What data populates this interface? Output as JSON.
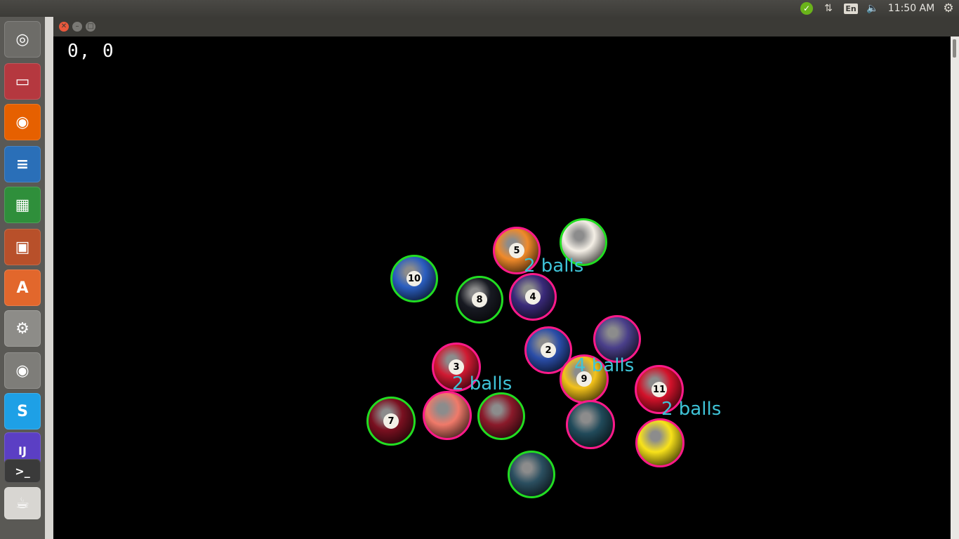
{
  "topbar": {
    "input_source": "En",
    "clock": "11:50 AM"
  },
  "launcher": {
    "items": [
      {
        "name": "ubuntu-dash-icon",
        "bg": "#6d6c68",
        "glyph": "◎"
      },
      {
        "name": "files-icon",
        "bg": "#b5383f",
        "glyph": "▭"
      },
      {
        "name": "firefox-icon",
        "bg": "#e66000",
        "glyph": "◉"
      },
      {
        "name": "writer-icon",
        "bg": "#2a6fb8",
        "glyph": "≡"
      },
      {
        "name": "calc-icon",
        "bg": "#2f8f3b",
        "glyph": "▦"
      },
      {
        "name": "impress-icon",
        "bg": "#b8502a",
        "glyph": "▣"
      },
      {
        "name": "software-center-icon",
        "bg": "#e2672c",
        "glyph": "A"
      },
      {
        "name": "system-settings-icon",
        "bg": "#8d8c88",
        "glyph": "⚙"
      },
      {
        "name": "chrome-icon",
        "bg": "#7e7d79",
        "glyph": "◉"
      },
      {
        "name": "skype-icon",
        "bg": "#1ea0e6",
        "glyph": "S"
      },
      {
        "name": "intellij-icon",
        "bg": "#5b3fc4",
        "glyph": "IJ"
      },
      {
        "name": "terminal-icon",
        "bg": "#3a3a3a",
        "glyph": ">_"
      },
      {
        "name": "java-icon",
        "bg": "#d8d6d2",
        "glyph": "☕"
      }
    ]
  },
  "window": {
    "coords_text": "0, 0"
  },
  "labels": [
    {
      "id": "lbl1",
      "text": "2 balls"
    },
    {
      "id": "lbl2",
      "text": "4 balls"
    },
    {
      "id": "lbl3",
      "text": "2 balls"
    },
    {
      "id": "lbl4",
      "text": "2 balls"
    }
  ],
  "balls": [
    {
      "number": "10",
      "color": "#2b5ec0",
      "ring": "#22dd22"
    },
    {
      "number": "5",
      "color": "#f08a2a",
      "ring": "#ff1a8a"
    },
    {
      "number": "",
      "color": "#f4efe6",
      "ring": "#22dd22"
    },
    {
      "number": "8",
      "color": "#181a22",
      "ring": "#22dd22"
    },
    {
      "number": "4",
      "color": "#3a2a7a",
      "ring": "#ff1a8a"
    },
    {
      "number": "2",
      "color": "#2a4da8",
      "ring": "#ff1a8a"
    },
    {
      "number": "",
      "color": "#4a3f8a",
      "ring": "#ff1a8a"
    },
    {
      "number": "3",
      "color": "#d01a32",
      "ring": "#ff1a8a"
    },
    {
      "number": "9",
      "color": "#f3c21a",
      "ring": "#ff1a8a"
    },
    {
      "number": "11",
      "color": "#d2122a",
      "ring": "#ff1a8a"
    },
    {
      "number": "7",
      "color": "#7a1020",
      "ring": "#22dd22"
    },
    {
      "number": "",
      "color": "#f07a6a",
      "ring": "#ff1a8a"
    },
    {
      "number": "",
      "color": "#8a1a2a",
      "ring": "#22dd22"
    },
    {
      "number": "",
      "color": "#214a5a",
      "ring": "#ff1a8a"
    },
    {
      "number": "",
      "color": "#f8e21a",
      "ring": "#ff1a8a"
    },
    {
      "number": "",
      "color": "#2b4f60",
      "ring": "#22dd22"
    }
  ]
}
